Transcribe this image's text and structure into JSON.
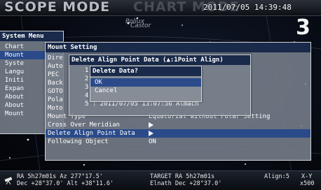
{
  "header": {
    "mode": "SCOPE MODE",
    "mode_ghost": "CHART MODE",
    "datetime": "2011/07/05 14:39:48",
    "page_number": "3"
  },
  "sky_labels": [
    "Pollux",
    "Castor"
  ],
  "system_menu": {
    "title": "System Menu",
    "items": [
      "Chart",
      "Mount",
      "Syste",
      "Langu",
      "Initi",
      "Expan",
      "About",
      "About",
      "Mount"
    ]
  },
  "mount_setting": {
    "title": "Mount Setting",
    "items": [
      {
        "label": "Dire",
        "value": ""
      },
      {
        "label": "Auto",
        "value": ""
      },
      {
        "label": "PEC",
        "value": ""
      },
      {
        "label": "Back",
        "value": ""
      },
      {
        "label": "GOTO",
        "value": ""
      },
      {
        "label": "Pola",
        "value": ""
      },
      {
        "label": "Moto",
        "value": ""
      },
      {
        "label": "Mount Type",
        "value": "Equatorial without Polar Setting"
      },
      {
        "label": "Cross Over Meridian",
        "value": "▶"
      },
      {
        "label": "Delete Align Point Data",
        "value": "▶"
      },
      {
        "label": "Following Object",
        "value": "ON"
      }
    ]
  },
  "delete_align_point": {
    "title": "Delete Align Point Data (▲:1Point Align)",
    "items": [
      {
        "num": "1",
        "text": ""
      },
      {
        "num": "2",
        "text": ""
      },
      {
        "num": "3",
        "text": ""
      },
      {
        "num": "4",
        "text": ""
      },
      {
        "num": "5",
        "text": ": 2011/07/05 13:07:56 Almach"
      }
    ]
  },
  "delete_data_dialog": {
    "title": "Delete Data?",
    "ok": "OK",
    "cancel": "Cancel"
  },
  "status_bar": {
    "line1_left": "RA  5h27m01s  Az 277°17.5'",
    "line2_left": "Dec +28°37.0'  Alt +38°11.6'",
    "line1_mid": "TARGET   RA  5h27m01s",
    "line2_mid": "Elnath   Dec +28°37.0'",
    "align": "Align:5",
    "xy": "X-Y",
    "zoom": "x500"
  }
}
